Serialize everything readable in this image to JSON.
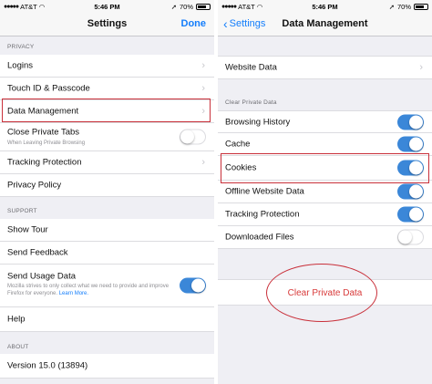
{
  "left": {
    "status": {
      "carrier": "AT&T",
      "time": "5:46 PM",
      "battery": "70%"
    },
    "nav": {
      "title": "Settings",
      "done_label": "Done"
    },
    "privacy_header": "PRIVACY",
    "privacy_rows": [
      {
        "label": "Logins"
      },
      {
        "label": "Touch ID & Passcode"
      },
      {
        "label": "Data Management"
      },
      {
        "label": "Close Private Tabs",
        "sub": "When Leaving Private Browsing",
        "toggle": "off"
      },
      {
        "label": "Tracking Protection"
      },
      {
        "label": "Privacy Policy"
      }
    ],
    "support_header": "SUPPORT",
    "support_rows": [
      {
        "label": "Show Tour"
      },
      {
        "label": "Send Feedback"
      },
      {
        "label": "Send Usage Data",
        "sub": "Mozilla strives to only collect what we need to provide and improve Firefox for everyone.",
        "learn_more": "Learn More.",
        "toggle": "on"
      },
      {
        "label": "Help"
      }
    ],
    "about_header": "ABOUT",
    "about_rows": [
      {
        "label": "Version 15.0 (13894)"
      }
    ]
  },
  "right": {
    "status": {
      "carrier": "AT&T",
      "time": "5:46 PM",
      "battery": "70%"
    },
    "nav": {
      "title": "Data Management",
      "back_label": "Settings"
    },
    "website_data_label": "Website Data",
    "clear_header": "Clear Private Data",
    "items": [
      {
        "label": "Browsing History",
        "toggle": "on"
      },
      {
        "label": "Cache",
        "toggle": "on"
      },
      {
        "label": "Cookies",
        "toggle": "on"
      },
      {
        "label": "Offline Website Data",
        "toggle": "on"
      },
      {
        "label": "Tracking Protection",
        "toggle": "on"
      },
      {
        "label": "Downloaded Files",
        "toggle": "off"
      }
    ],
    "clear_button_label": "Clear Private Data"
  },
  "colors": {
    "accent": "#147efb",
    "toggle_on": "#3b87d8",
    "annotation": "#c9303a",
    "destructive": "#d83a3a"
  }
}
